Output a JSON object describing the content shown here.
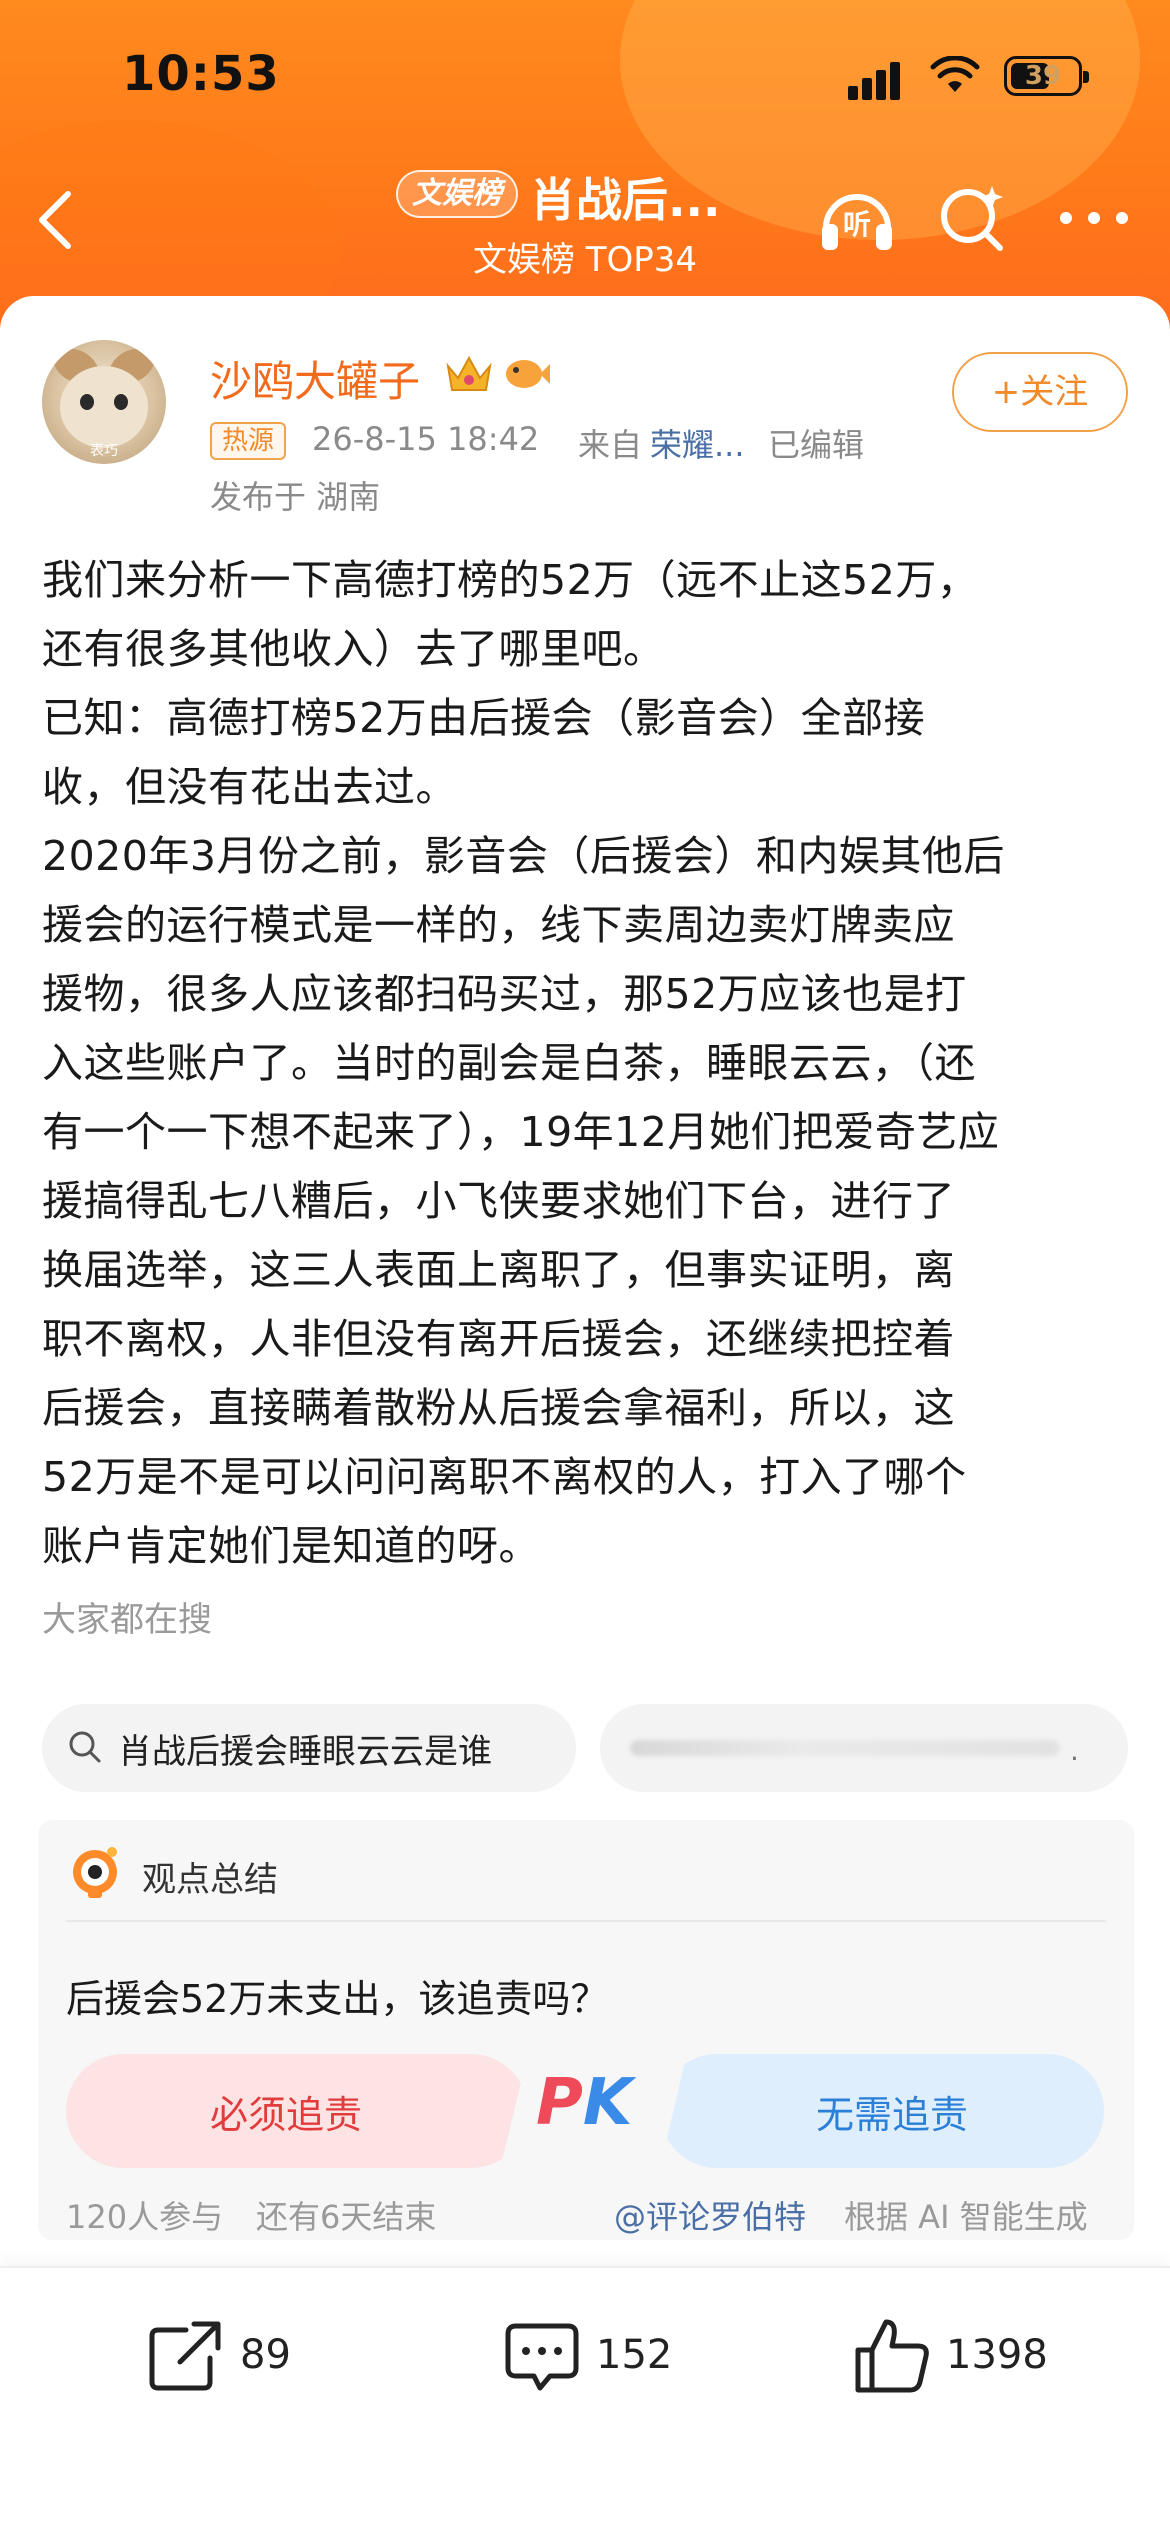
{
  "status_bar": {
    "time": "10:53",
    "battery": "39"
  },
  "nav": {
    "tag": "文娱榜",
    "title": "肖战后...",
    "subtitle": "文娱榜 TOP34"
  },
  "post": {
    "user_name": "沙鸥大罐子",
    "avatar_caption": "表巧",
    "hot_tag": "热源",
    "time": "26-8-15 18:42",
    "from_label": "来自",
    "device": "荣耀...",
    "edited": "已编辑",
    "location": "发布于 湖南",
    "follow_label": "+关注",
    "text": "我们来分析一下高德打榜的52万（远不止这52万，\n还有很多其他收入）去了哪里吧。\n已知：高德打榜52万由后援会（影音会）全部接\n收，但没有花出去过。\n2020年3月份之前，影音会（后援会）和内娱其他后\n援会的运行模式是一样的，线下卖周边卖灯牌卖应\n援物，很多人应该都扫码买过，那52万应该也是打\n入这些账户了。当时的副会是白茶，睡眼云云，（还\n有一个一下想不起来了），19年12月她们把爱奇艺应\n援搞得乱七八糟后，小飞侠要求她们下台，进行了\n换届选举，这三人表面上离职了，但事实证明，离\n职不离权，人非但没有离开后援会，还继续把控着\n后援会，直接瞒着散粉从后援会拿福利，所以，这\n52万是不是可以问问离职不离权的人，打入了哪个\n账户肯定她们是知道的呀。"
  },
  "search": {
    "heading": "大家都在搜",
    "chips": [
      "肖战后援会睡眼云云是谁",
      "."
    ]
  },
  "opinion": {
    "title": "观点总结",
    "question": "后援会52万未支出，该追责吗？",
    "left_option": "必须追责",
    "right_option": "无需追责",
    "pk_p": "P",
    "pk_k": "K",
    "participants": "120人参与",
    "remaining": "还有6天结束",
    "author": "@评论罗伯特",
    "source": "根据 AI 智能生成"
  },
  "actions": {
    "share_count": "89",
    "comment_count": "152",
    "like_count": "1398"
  },
  "colors": {
    "header_orange": "#ff7a1a",
    "accent_orange": "#f26b1d",
    "link_blue": "#4a6fa5",
    "pk_red": "#e23b3b",
    "pk_blue": "#2a7fd8"
  }
}
